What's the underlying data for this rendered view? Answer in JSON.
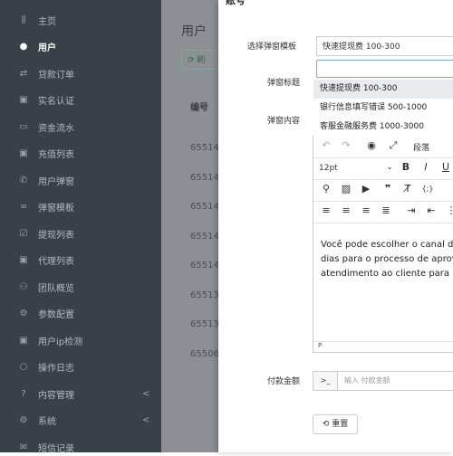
{
  "sidebar": {
    "items": [
      {
        "icon": "chart-icon",
        "glyph": "⫼",
        "label": "主页"
      },
      {
        "icon": "user-icon",
        "glyph": "●",
        "label": "用户",
        "active": true
      },
      {
        "icon": "loan-icon",
        "glyph": "⇄",
        "label": "贷款订单"
      },
      {
        "icon": "id-card-icon",
        "glyph": "▣",
        "label": "实名认证"
      },
      {
        "icon": "money-icon",
        "glyph": "▭",
        "label": "资金流水"
      },
      {
        "icon": "recharge-icon",
        "glyph": "▣",
        "label": "充值列表"
      },
      {
        "icon": "phone-icon",
        "glyph": "✆",
        "label": "用户弹窗"
      },
      {
        "icon": "link-icon",
        "glyph": "∞",
        "label": "弹窗模板"
      },
      {
        "icon": "check-icon",
        "glyph": "☑",
        "label": "提现列表"
      },
      {
        "icon": "agent-icon",
        "glyph": "▣",
        "label": "代理列表"
      },
      {
        "icon": "team-icon",
        "glyph": "⚇",
        "label": "团队概览"
      },
      {
        "icon": "settings-icon",
        "glyph": "⚙",
        "label": "参数配置"
      },
      {
        "icon": "ip-icon",
        "glyph": "▣",
        "label": "用户ip检测"
      },
      {
        "icon": "log-icon",
        "glyph": "○",
        "label": "操作日志"
      },
      {
        "icon": "help-icon",
        "glyph": "?",
        "label": "内容管理",
        "arrow": "<"
      },
      {
        "icon": "gear-icon",
        "glyph": "⚙",
        "label": "系统",
        "arrow": "<"
      },
      {
        "icon": "sms-icon",
        "glyph": "✉",
        "label": "短信记录"
      }
    ]
  },
  "background": {
    "title": "用户",
    "refresh_label": "⟳ 刷",
    "col_label": "编号",
    "rows": [
      "65514",
      "65514",
      "65514",
      "65514",
      "65514",
      "65513",
      "65513",
      "65506"
    ]
  },
  "modal": {
    "title_fragment": "账号",
    "labels": {
      "template": "选择弹窗模板",
      "title": "弹窗标题",
      "content": "弹窗内容",
      "amount": "付款金额"
    },
    "selected_template": "快速提现费 100-300",
    "title_value": "",
    "dropdown_options": [
      "快速提现费 100-300",
      "银行信息填写错误 500-1000",
      "客服金融服务费 1000-3000"
    ],
    "editor": {
      "block_format": "段落",
      "font_size": "12pt",
      "content_lines": [
        "Você pode escolher o canal d",
        "dias para o processo de aprov",
        "atendimento ao cliente para m"
      ],
      "status_path": "P"
    },
    "amount_prefix": ">_",
    "amount_placeholder": "输入 付款金额",
    "reset_label": "⟲ 重置"
  }
}
